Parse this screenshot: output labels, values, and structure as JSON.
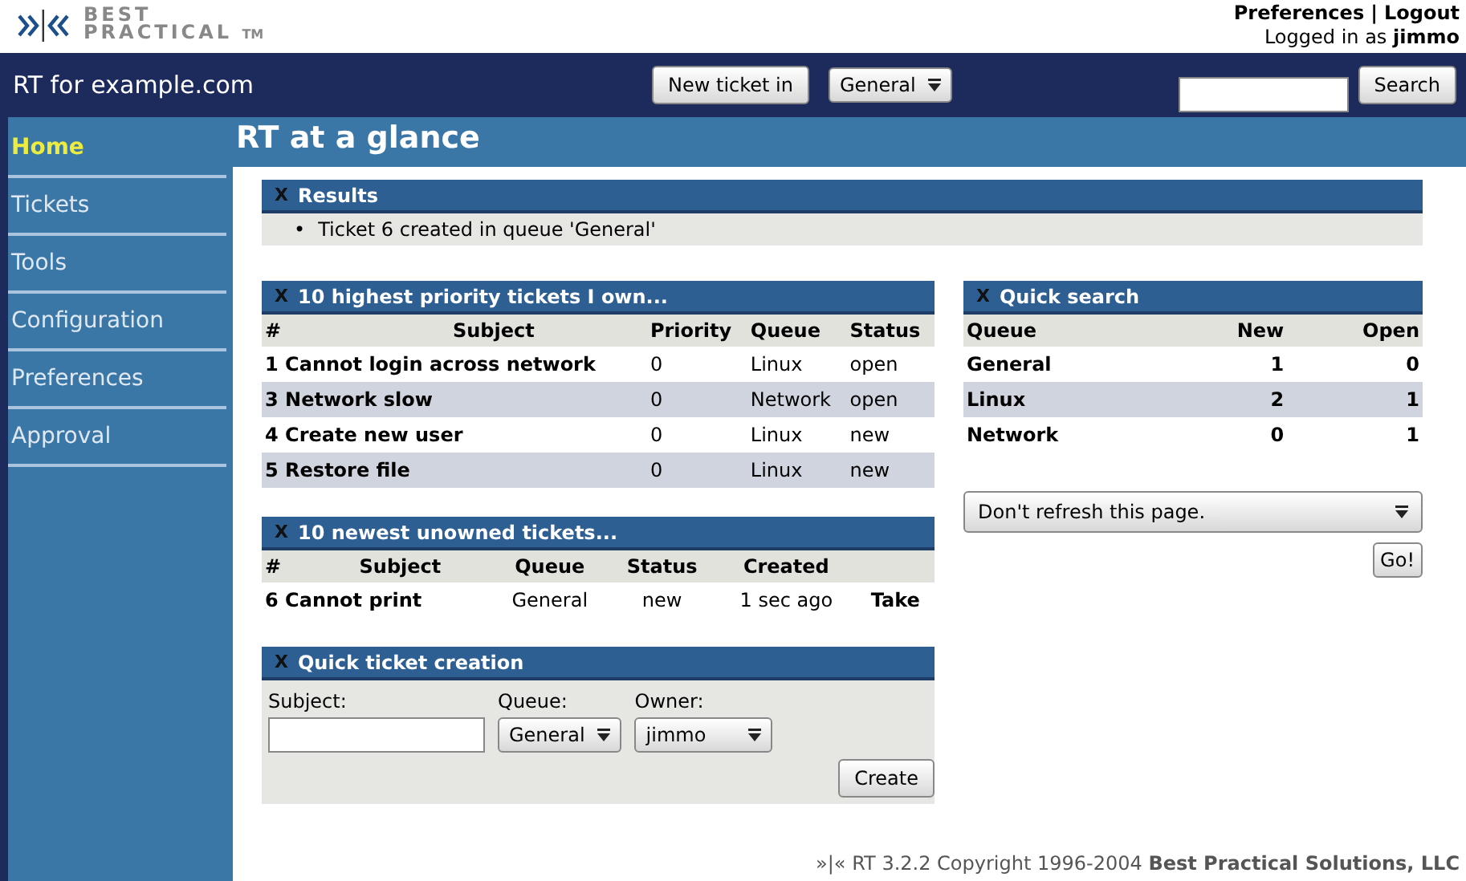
{
  "header": {
    "logo_top": "BEST",
    "logo_bottom": "PRACTICAL",
    "trademark": "TM",
    "links": [
      "Preferences",
      "Logout"
    ],
    "separator": "|",
    "logged_in_label": "Logged in as",
    "user": "jimmo"
  },
  "navbar": {
    "site": "RT for example.com",
    "new_ticket_button": "New ticket in",
    "queue_select": "General",
    "search_button": "Search"
  },
  "sidebar": {
    "items": [
      {
        "label": "Home",
        "selected": true
      },
      {
        "label": "Tickets",
        "selected": false
      },
      {
        "label": "Tools",
        "selected": false
      },
      {
        "label": "Configuration",
        "selected": false
      },
      {
        "label": "Preferences",
        "selected": false
      },
      {
        "label": "Approval",
        "selected": false
      }
    ]
  },
  "page_title": "RT at a glance",
  "results": {
    "close": "X",
    "title": "Results",
    "bullet": "•",
    "messages": [
      "Ticket 6 created in queue 'General'"
    ]
  },
  "my_tickets": {
    "close": "X",
    "title": "10 highest priority tickets I own...",
    "columns": [
      "#",
      "Subject",
      "Priority",
      "Queue",
      "Status"
    ],
    "rows": [
      {
        "id": "1",
        "subject": "Cannot login across network",
        "priority": "0",
        "queue": "Linux",
        "status": "open"
      },
      {
        "id": "3",
        "subject": "Network slow",
        "priority": "0",
        "queue": "Network",
        "status": "open"
      },
      {
        "id": "4",
        "subject": "Create new user",
        "priority": "0",
        "queue": "Linux",
        "status": "new"
      },
      {
        "id": "5",
        "subject": "Restore file",
        "priority": "0",
        "queue": "Linux",
        "status": "new"
      }
    ]
  },
  "unowned_tickets": {
    "close": "X",
    "title": "10 newest unowned tickets...",
    "columns": [
      "#",
      "Subject",
      "Queue",
      "Status",
      "Created"
    ],
    "rows": [
      {
        "id": "6",
        "subject": "Cannot print",
        "queue": "General",
        "status": "new",
        "created": "1 sec ago",
        "action": "Take"
      }
    ]
  },
  "quick_create": {
    "close": "X",
    "title": "Quick ticket creation",
    "subject_label": "Subject:",
    "queue_label": "Queue:",
    "queue_value": "General",
    "owner_label": "Owner:",
    "owner_value": "jimmo",
    "create_button": "Create"
  },
  "quick_search": {
    "close": "X",
    "title": "Quick search",
    "columns": [
      "Queue",
      "New",
      "Open"
    ],
    "rows": [
      {
        "queue": "General",
        "new": "1",
        "open": "0"
      },
      {
        "queue": "Linux",
        "new": "2",
        "open": "1"
      },
      {
        "queue": "Network",
        "new": "0",
        "open": "1"
      }
    ],
    "refresh_select": "Don't refresh this page.",
    "go_button": "Go!"
  },
  "footer": {
    "text": "»|« RT 3.2.2 Copyright 1996-2004 **Best Practical Solutions, LLC**"
  }
}
